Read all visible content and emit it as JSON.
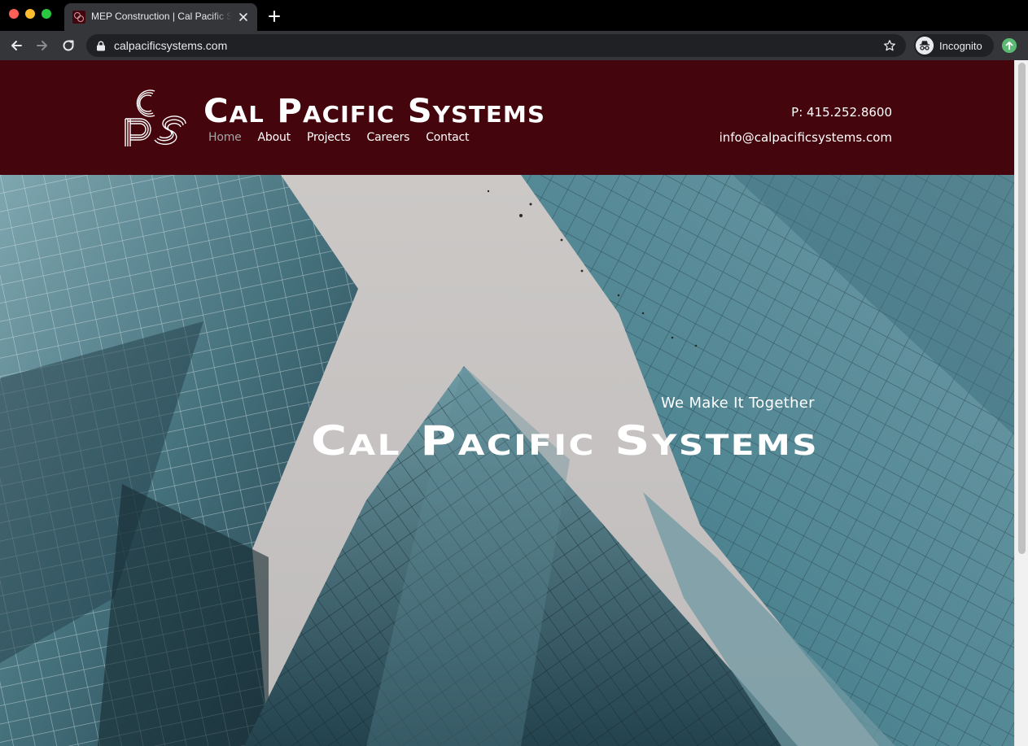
{
  "browser": {
    "tab_title": "MEP Construction | Cal Pacific Systems",
    "url": "calpacificsystems.com",
    "profile_label": "Incognito",
    "icons": [
      "back-icon",
      "forward-icon",
      "reload-icon",
      "lock-icon",
      "star-icon",
      "incognito-icon",
      "update-icon",
      "close-icon",
      "plus-icon"
    ]
  },
  "site": {
    "brand": "Cal Pacific Systems",
    "logo_monogram": "CPS",
    "nav": [
      {
        "label": "Home",
        "active": true
      },
      {
        "label": "About",
        "active": false
      },
      {
        "label": "Projects",
        "active": false
      },
      {
        "label": "Careers",
        "active": false
      },
      {
        "label": "Contact",
        "active": false
      }
    ],
    "phone": "P: 415.252.8600",
    "email": "info@calpacificsystems.com",
    "header_color": "#45050d"
  },
  "hero": {
    "tagline": "We Make It Together",
    "title": "Cal Pacific Systems"
  }
}
